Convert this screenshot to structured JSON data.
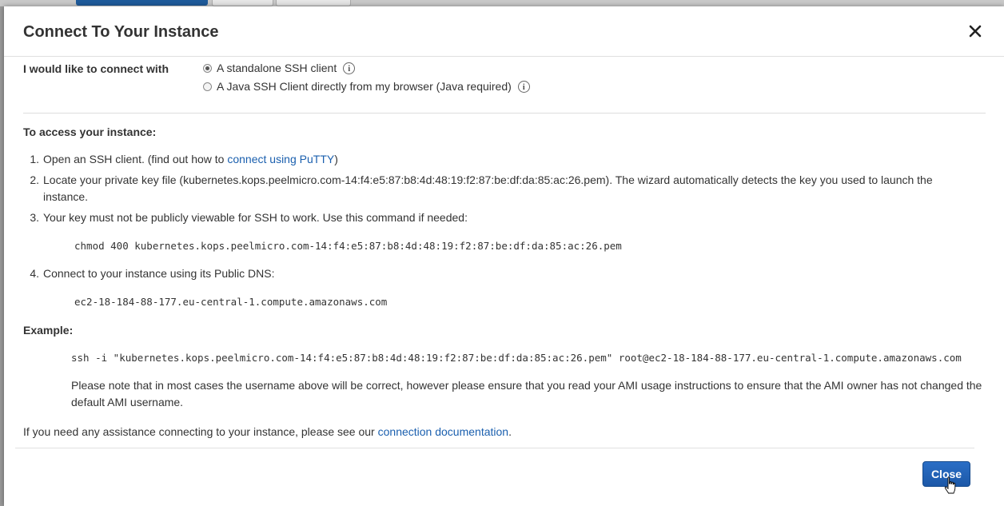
{
  "dialog": {
    "title": "Connect To Your Instance"
  },
  "connect_with": {
    "label": "I would like to connect with",
    "options": [
      {
        "label": "A standalone SSH client",
        "selected": true
      },
      {
        "label": "A Java SSH Client directly from my browser (Java required)",
        "selected": false
      }
    ]
  },
  "access": {
    "heading": "To access your instance:",
    "steps": [
      {
        "num": "1.",
        "text_before": "Open an SSH client. (find out how to",
        "link": "connect using PuTTY",
        "text_after": ")"
      },
      {
        "num": "2.",
        "text": "Locate your private key file (kubernetes.kops.peelmicro.com-14:f4:e5:87:b8:4d:48:19:f2:87:be:df:da:85:ac:26.pem). The wizard automatically detects the key you used to launch the instance."
      },
      {
        "num": "3.",
        "text": "Your key must not be publicly viewable for SSH to work. Use this command if needed:",
        "code": "chmod 400 kubernetes.kops.peelmicro.com-14:f4:e5:87:b8:4d:48:19:f2:87:be:df:da:85:ac:26.pem"
      },
      {
        "num": "4.",
        "text": "Connect to your instance using its Public DNS:",
        "code": "ec2-18-184-88-177.eu-central-1.compute.amazonaws.com"
      }
    ]
  },
  "example": {
    "heading": "Example:",
    "command": "ssh -i \"kubernetes.kops.peelmicro.com-14:f4:e5:87:b8:4d:48:19:f2:87:be:df:da:85:ac:26.pem\" root@ec2-18-184-88-177.eu-central-1.compute.amazonaws.com",
    "note": "Please note that in most cases the username above will be correct, however please ensure that you read your AMI usage instructions to ensure that the AMI owner has not changed the default AMI username."
  },
  "help": {
    "text": "If you need any assistance connecting to your instance, please see our",
    "link": "connection documentation",
    "suffix": "."
  },
  "footer": {
    "close_label": "Close"
  },
  "colors": {
    "primary_button": "#1c58a8",
    "link": "#1a5fae"
  }
}
